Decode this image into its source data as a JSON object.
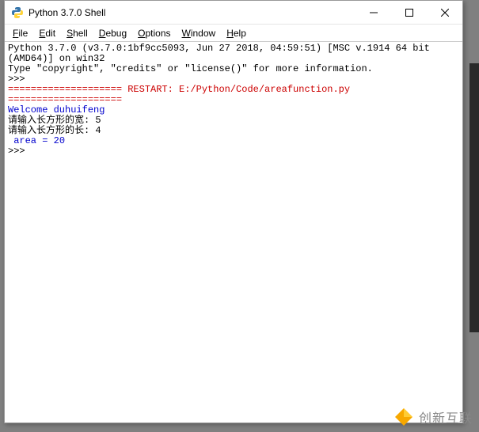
{
  "window": {
    "title": "Python 3.7.0 Shell"
  },
  "menubar": {
    "items": [
      {
        "label": "File",
        "accel": "F"
      },
      {
        "label": "Edit",
        "accel": "E"
      },
      {
        "label": "Shell",
        "accel": "S"
      },
      {
        "label": "Debug",
        "accel": "D"
      },
      {
        "label": "Options",
        "accel": "O"
      },
      {
        "label": "Window",
        "accel": "W"
      },
      {
        "label": "Help",
        "accel": "H"
      }
    ]
  },
  "shell": {
    "banner1": "Python 3.7.0 (v3.7.0:1bf9cc5093, Jun 27 2018, 04:59:51) [MSC v.1914 64 bit (AMD64)] on win32",
    "banner2": "Type \"copyright\", \"credits\" or \"license()\" for more information.",
    "prompt": ">>> ",
    "restart": "==================== RESTART: E:/Python/Code/areafunction.py ====================",
    "welcome": "Welcome duhuifeng",
    "input1_label": "请输入长方形的宽: ",
    "input1_value": "5",
    "input2_label": "请输入长方形的长: ",
    "input2_value": "4",
    "result": " area = 20"
  },
  "watermark": {
    "text": "创新互联"
  }
}
